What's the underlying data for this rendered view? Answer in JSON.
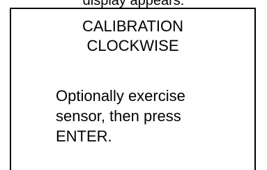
{
  "caption": "display appears:",
  "screen": {
    "title_lines": [
      "CALIBRATION",
      "CLOCKWISE"
    ],
    "message_lines": [
      "Optionally exercise",
      "sensor, then press",
      "ENTER."
    ]
  }
}
